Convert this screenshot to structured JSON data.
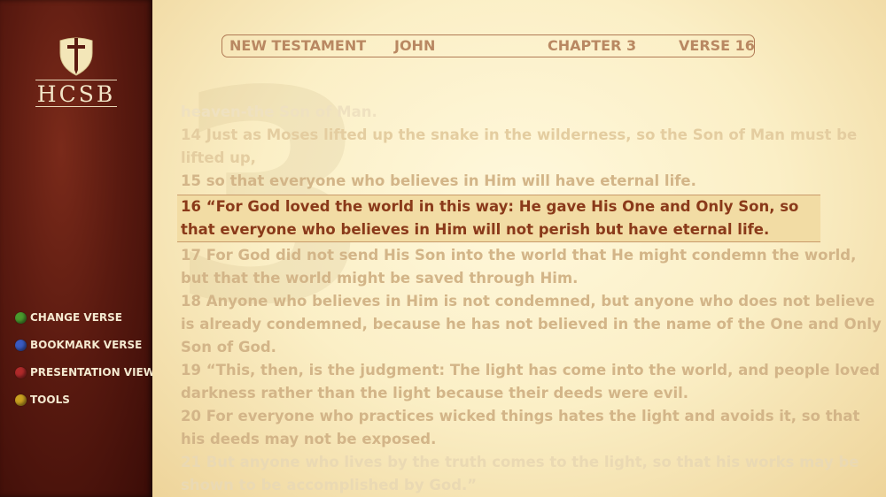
{
  "logo": {
    "text": "HCSB",
    "icon": "shield-sword-icon"
  },
  "menu": [
    {
      "label": "CHANGE VERSE",
      "color": "#4a9a2e",
      "icon": "green-dot-icon"
    },
    {
      "label": "BOOKMARK VERSE",
      "color": "#3a5ac0",
      "icon": "blue-dot-icon"
    },
    {
      "label": "PRESENTATION VIEW",
      "color": "#b02a2a",
      "icon": "red-dot-icon"
    },
    {
      "label": "TOOLS",
      "color": "#c9a020",
      "icon": "yellow-dot-icon"
    }
  ],
  "nav": {
    "testament": "NEW TESTAMENT",
    "book": "JOHN",
    "chapter": "CHAPTER 3",
    "verse": "VERSE 16"
  },
  "watermark": "3",
  "verses": {
    "v13_tail": "heaven-the Son of Man.",
    "v14": {
      "num": "14",
      "text": "Just as Moses lifted up the snake in the wilderness, so the Son of Man must be lifted up,"
    },
    "v15": {
      "num": "15",
      "text": "so that everyone who believes in Him will have eternal life."
    },
    "v16": {
      "num": "16",
      "text": "“For God loved the world in this way: He gave His One and Only Son, so that everyone who believes in Him will not perish but have eternal life."
    },
    "v17": {
      "num": "17",
      "text": "For God did not send His Son into the world that He might condemn the world, but that the world might be saved through Him."
    },
    "v18": {
      "num": "18",
      "text": "Anyone who believes in Him is not condemned, but anyone who does not believe is already condemned, because he has not believed in the name of the One and Only Son of God."
    },
    "v19": {
      "num": "19",
      "text": "“This, then, is the judgment: The light has come into the world, and people loved darkness rather than the light because their deeds were evil."
    },
    "v20": {
      "num": "20",
      "text": "For everyone who practices wicked things hates the light and avoids it, so that his deeds may not be exposed."
    },
    "v21": {
      "num": "21",
      "text": "But anyone who lives by the truth comes to the light, so that his works may be shown to be accomplished by God.”"
    }
  },
  "colors": {
    "highlight_text": "#8a3a1a",
    "sidebar": "#5a1a10"
  }
}
